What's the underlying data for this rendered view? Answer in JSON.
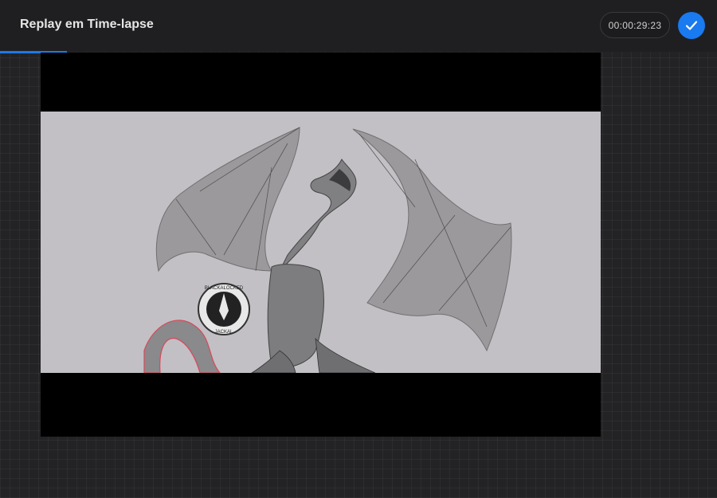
{
  "header": {
    "title": "Replay em Time-lapse",
    "timecode": "00:00:29:23",
    "done_icon": "checkmark-icon",
    "accent_color": "#1a7af0"
  },
  "playback": {
    "progress_fraction": 0.093
  },
  "video": {
    "artwork": "sketch-of-winged-dragon",
    "watermark_lines": [
      "BLACKALOCKED",
      "JACKAL"
    ]
  }
}
